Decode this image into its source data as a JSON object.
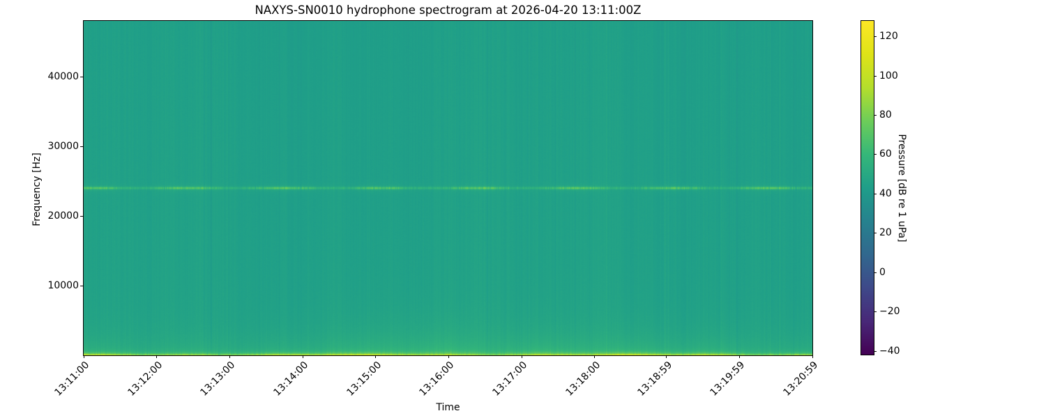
{
  "chart_data": {
    "type": "heatmap",
    "subtype": "hydrophone-spectrogram",
    "title": "NAXYS-SN0010 hydrophone spectrogram at 2026-04-20 13:11:00Z",
    "xlabel": "Time",
    "ylabel": "Frequency [Hz]",
    "x_axis": {
      "tick_labels": [
        "13:11:00",
        "13:12:00",
        "13:13:00",
        "13:14:00",
        "13:15:00",
        "13:16:00",
        "13:17:00",
        "13:18:00",
        "13:18:59",
        "13:19:59",
        "13:20:59"
      ],
      "tick_seconds": [
        0,
        60,
        120,
        180,
        240,
        300,
        360,
        420,
        479,
        539,
        599
      ],
      "total_seconds": 599,
      "start_time": "13:11:00",
      "end_time": "13:20:59"
    },
    "y_axis": {
      "tick_labels": [
        "10000",
        "20000",
        "30000",
        "40000"
      ],
      "tick_values": [
        10000,
        20000,
        30000,
        40000
      ],
      "range_hz": [
        0,
        48000
      ]
    },
    "grid": false,
    "legend": "none",
    "colorbar": {
      "label": "Pressure [dB re 1 uPa]",
      "tick_labels": [
        "120",
        "100",
        "80",
        "60",
        "40",
        "20",
        "0",
        "−20",
        "−40"
      ],
      "tick_values": [
        120,
        100,
        80,
        60,
        40,
        20,
        0,
        -20,
        -40
      ],
      "vmin": -41.8,
      "vmax": 127.8,
      "colormap": "viridis",
      "colormap_stops": [
        "#440154",
        "#482878",
        "#3e4989",
        "#31688e",
        "#26828e",
        "#1f9e89",
        "#35b779",
        "#6dcd59",
        "#b4de2c",
        "#dfe318",
        "#fde725"
      ]
    },
    "field_synthesis": {
      "seed": 42,
      "background_db": 44.7,
      "column_noise_db": 1.3,
      "pixel_noise_db": 0.7,
      "stripe_probability": 0.05,
      "stripe_db": 3.0,
      "vertical_tilt_db": 1.6,
      "tonal_line": {
        "freq_hz": 24000,
        "peak_db": 17,
        "base_db": 4,
        "sigma_hz": 130,
        "glow_db": 2.2,
        "glow_sigma_hz": 500
      },
      "surface_band": {
        "peak_db": 46,
        "efold_hz": 230,
        "broad_db": 9,
        "broad_efold_hz": 2400
      },
      "events": [
        {
          "t_frac": 0.17,
          "width_frac": 0.06,
          "efold_hz": 2000,
          "boost_db": 2.0
        },
        {
          "t_frac": 0.4,
          "width_frac": 0.065,
          "efold_hz": 4500,
          "boost_db": 3.2
        },
        {
          "t_frac": 0.475,
          "width_frac": 0.045,
          "efold_hz": 3800,
          "boost_db": 4.2
        },
        {
          "t_frac": 0.545,
          "width_frac": 0.05,
          "efold_hz": 3000,
          "boost_db": 5.0
        },
        {
          "t_frac": 0.625,
          "width_frac": 0.04,
          "efold_hz": 2600,
          "boost_db": 4.0
        },
        {
          "t_frac": 0.69,
          "width_frac": 0.045,
          "efold_hz": 3400,
          "boost_db": 3.2
        },
        {
          "t_frac": 0.8,
          "width_frac": 0.05,
          "efold_hz": 2400,
          "boost_db": 2.6
        },
        {
          "t_frac": 0.915,
          "width_frac": 0.05,
          "efold_hz": 2800,
          "boost_db": 2.8
        }
      ]
    }
  }
}
